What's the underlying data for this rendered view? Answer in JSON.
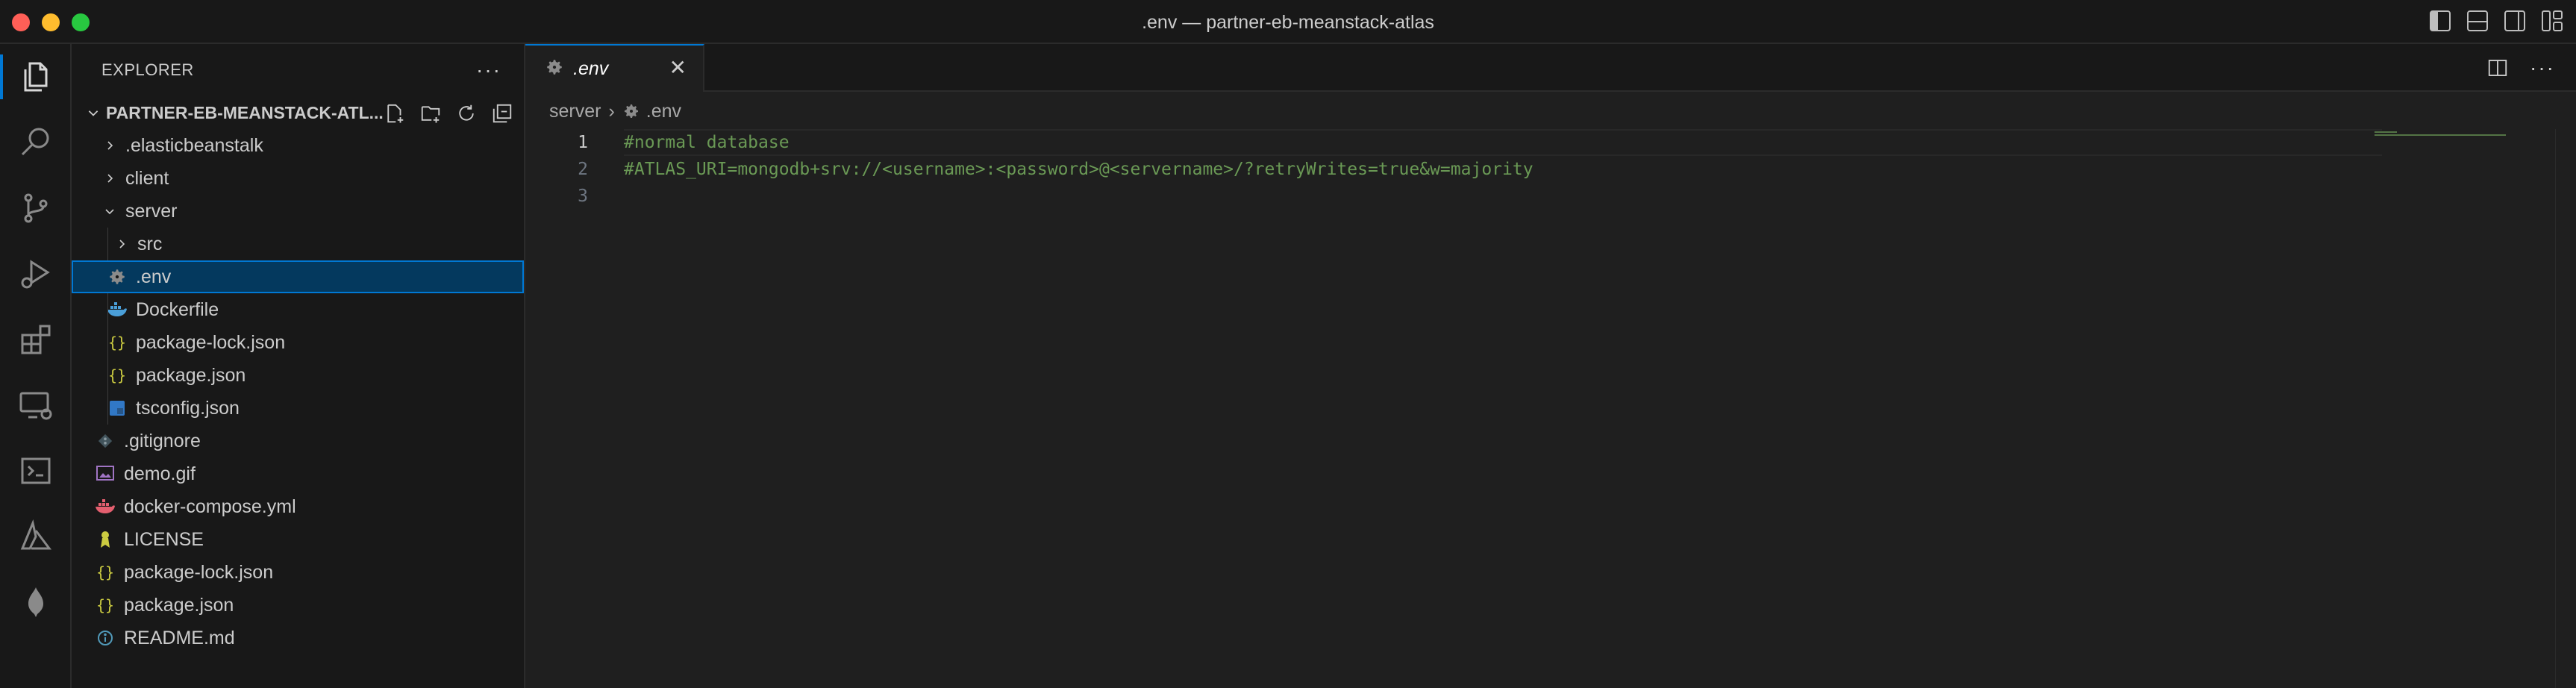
{
  "window": {
    "title": ".env — partner-eb-meanstack-atlas"
  },
  "activity_bar": {
    "items": [
      "explorer-icon",
      "search-icon",
      "source-control-icon",
      "run-debug-icon",
      "extensions-icon",
      "remote-explorer-icon",
      "terminal-icon",
      "azure-icon",
      "mongodb-icon"
    ],
    "active": "explorer-icon",
    "accent": "#0078d4"
  },
  "sidebar": {
    "title": "EXPLORER",
    "more": "···",
    "folder": "PARTNER-EB-MEANSTACK-ATL...",
    "tree": [
      {
        "label": ".elasticbeanstalk",
        "icon": "chevron-right-icon"
      },
      {
        "label": "client",
        "icon": "chevron-right-icon"
      },
      {
        "label": "server",
        "icon": "chevron-down-icon"
      },
      {
        "label": "src",
        "icon": "chevron-right-icon"
      },
      {
        "label": ".env",
        "icon": "gear-icon"
      },
      {
        "label": "Dockerfile",
        "icon": "docker-icon"
      },
      {
        "label": "package-lock.json",
        "icon": "json-icon"
      },
      {
        "label": "package.json",
        "icon": "json-icon"
      },
      {
        "label": "tsconfig.json",
        "icon": "typescript-config-icon"
      },
      {
        "label": ".gitignore",
        "icon": "git-icon"
      },
      {
        "label": "demo.gif",
        "icon": "image-icon"
      },
      {
        "label": "docker-compose.yml",
        "icon": "docker-compose-icon"
      },
      {
        "label": "LICENSE",
        "icon": "license-icon"
      },
      {
        "label": "package-lock.json",
        "icon": "json-icon"
      },
      {
        "label": "package.json",
        "icon": "json-icon"
      },
      {
        "label": "README.md",
        "icon": "info-icon"
      }
    ],
    "selected": ".env"
  },
  "editor": {
    "tab": {
      "label": ".env",
      "close": "✕"
    },
    "breadcrumb": {
      "folder": "server",
      "separator": "›",
      "file": ".env"
    },
    "line_numbers": [
      "1",
      "2",
      "3"
    ],
    "lines": [
      "#normal database",
      "#ATLAS_URI=mongodb+srv://<username>:<password>@<servername>/?retryWrites=true&w=majority",
      ""
    ],
    "comment_color": "#6a9955"
  }
}
